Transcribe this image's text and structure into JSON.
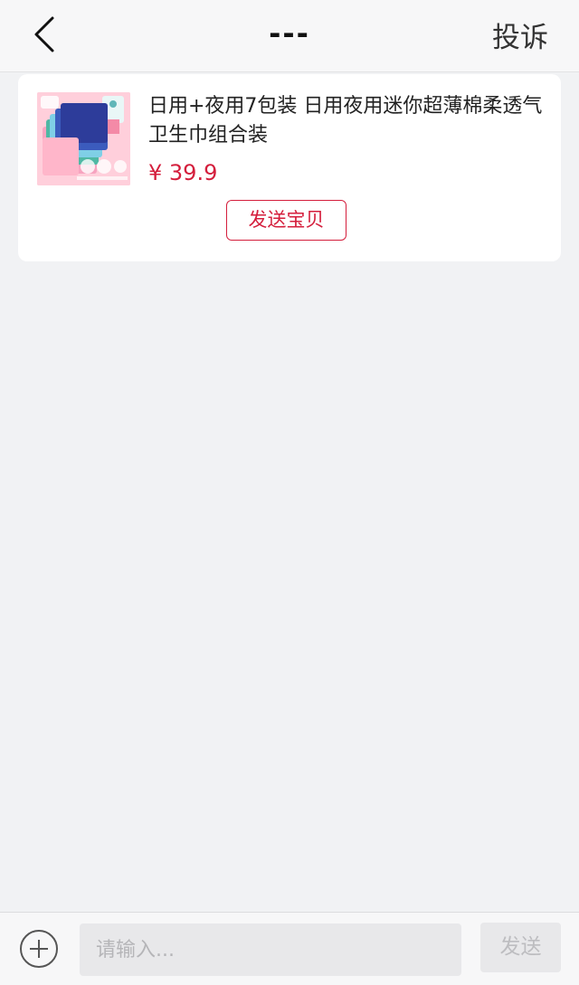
{
  "header": {
    "title": "---",
    "report_label": "投诉",
    "back_icon": "chevron-left-icon"
  },
  "product": {
    "title": "日用+夜用7包装 日用夜用迷你超薄棉柔透气卫生巾组合装",
    "price": "¥ 39.9",
    "send_button_label": "发送宝贝",
    "image_icon": "product-image-sanitary-pads"
  },
  "input_bar": {
    "placeholder": "请输入...",
    "value": "",
    "send_label": "发送",
    "plus_icon": "plus-circle-icon"
  },
  "colors": {
    "accent": "#d41e3c",
    "background": "#f1f2f4",
    "nav_background": "#f7f7f8",
    "card_background": "#ffffff",
    "text_primary": "#222222",
    "muted": "#bdbdc0"
  }
}
